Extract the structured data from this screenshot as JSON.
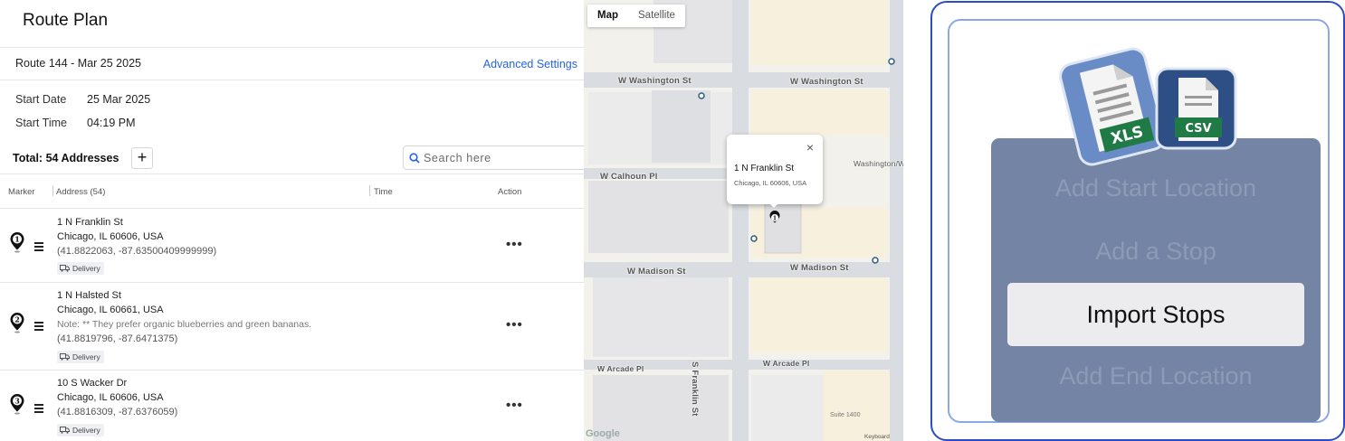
{
  "header": {
    "title": "Route Plan"
  },
  "route": {
    "name": "Route 144 - Mar 25 2025",
    "advanced_settings": "Advanced Settings",
    "start_date_label": "Start Date",
    "start_date": "25 Mar 2025",
    "start_time_label": "Start Time",
    "start_time": "04:19 PM"
  },
  "list": {
    "total": "Total: 54 Addresses",
    "add_label": "+",
    "search_placeholder": "Search here",
    "columns": {
      "marker": "Marker",
      "address": "Address (54)",
      "time": "Time",
      "action": "Action"
    },
    "stops": [
      {
        "number": "1",
        "line1": "1 N Franklin St",
        "line2": "Chicago, IL 60606, USA",
        "note": "",
        "coords": "(41.8822063, -87.63500409999999)",
        "tag": "Delivery",
        "menu": "•••"
      },
      {
        "number": "2",
        "line1": "1 N Halsted St",
        "line2": "Chicago, IL 60661, USA",
        "note": "Note: ** They prefer organic blueberries and green bananas.",
        "coords": "(41.8819796, -87.6471375)",
        "tag": "Delivery",
        "menu": "•••"
      },
      {
        "number": "3",
        "line1": "10 S Wacker Dr",
        "line2": "Chicago, IL 60606, USA",
        "note": "",
        "coords": "(41.8816309, -87.6376059)",
        "tag": "Delivery",
        "menu": "•••"
      }
    ]
  },
  "map": {
    "tabs": [
      "Map",
      "Satellite"
    ],
    "streets": {
      "washington_left": "W Washington St",
      "washington_right": "W Washington St",
      "calhoun": "W Calhoun Pl",
      "madison_left": "W Madison St",
      "madison_right": "W Madison St",
      "arcade_left": "W Arcade Pl",
      "arcade_right": "W Arcade Pl",
      "franklin": "S Franklin St",
      "washington_station": "Washington/W"
    },
    "popup": {
      "title": "1 N Franklin St",
      "subtitle": "Chicago, IL 60606, USA",
      "close": "×"
    },
    "marker_number": "1",
    "suite": "Suite 1400",
    "attribution": "Google",
    "keyboard": "Keyboard"
  },
  "import_menu": {
    "xls_label": "XLS",
    "csv_label": "CSV",
    "items": {
      "start": "Add Start Location",
      "stop": "Add a Stop",
      "import": "Import Stops",
      "end": "Add End Location"
    }
  },
  "colors": {
    "link": "#2563eb",
    "menu_bg": "#7384a4",
    "accent_border": "#2a4cc6",
    "xls_green": "#1f7a45",
    "csv_green": "#1f7a45"
  }
}
